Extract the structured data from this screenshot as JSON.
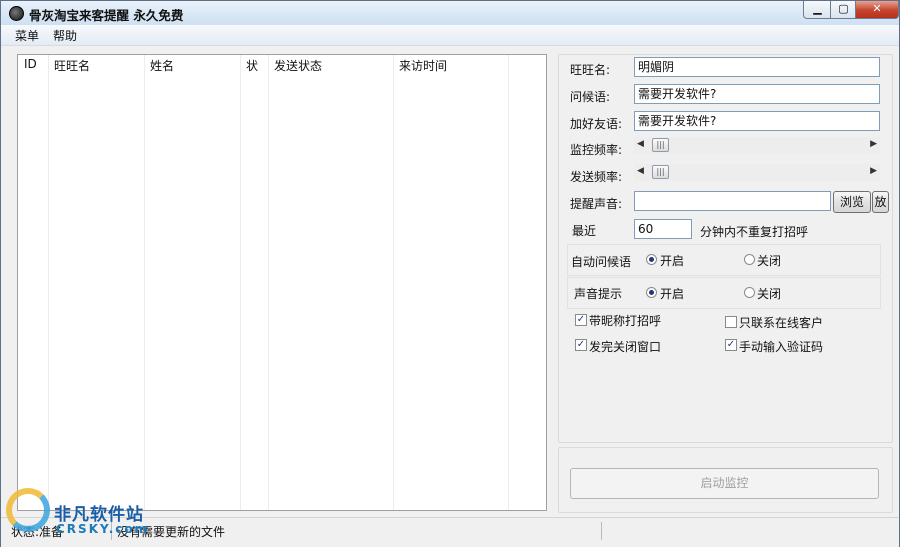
{
  "window": {
    "title": "骨灰淘宝来客提醒  永久免费",
    "min_label": "▁",
    "max_label": "▢",
    "close_label": "✕"
  },
  "menu": {
    "items": [
      "菜单",
      "帮助"
    ]
  },
  "table": {
    "columns": [
      "ID",
      "旺旺名",
      "姓名",
      "状",
      "发送状态",
      "来访时间"
    ],
    "rows": []
  },
  "form": {
    "wangwang_label": "旺旺名:",
    "wangwang_value": "明媚阴",
    "greeting_label": "问候语:",
    "greeting_value": "需要开发软件?",
    "friend_msg_label": "加好友语:",
    "friend_msg_value": "需要开发软件?",
    "monitor_freq_label": "监控频率:",
    "monitor_freq_value": 0.0,
    "send_freq_label": "发送频率:",
    "send_freq_value": 0.0,
    "sound_label": "提醒声音:",
    "sound_value": "",
    "browse_label": "浏览",
    "play_label": "放",
    "recent_label": "最近",
    "recent_value": "60",
    "recent_suffix": "分钟内不重复打招呼",
    "auto_greeting_label": "自动问候语",
    "auto_greeting_on": "开启",
    "auto_greeting_off": "关闭",
    "auto_greeting_selected": "开启",
    "sound_tip_label": "声音提示",
    "sound_tip_on": "开启",
    "sound_tip_off": "关闭",
    "sound_tip_selected": "开启",
    "checkboxes": [
      {
        "label": "带昵称打招呼",
        "checked": true
      },
      {
        "label": "只联系在线客户",
        "checked": false
      },
      {
        "label": "发完关闭窗口",
        "checked": true
      },
      {
        "label": "手动输入验证码",
        "checked": true
      }
    ],
    "start_button": "启动监控"
  },
  "status": {
    "left": "状态:准备",
    "middle": "没有需要更新的文件"
  },
  "watermark": {
    "cn": "非凡软件站",
    "en": "CRSKY.com"
  },
  "colors": {
    "title_gradient_top": "#eaf2fb",
    "close_red": "#c5442c",
    "text_box_border": "#7f9db9",
    "watermark_blue": "#1b5ea8"
  }
}
